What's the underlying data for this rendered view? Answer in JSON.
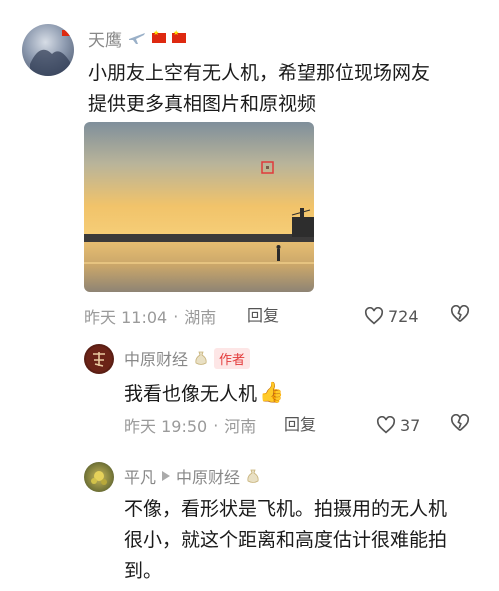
{
  "comment1": {
    "username": "天鹰",
    "text_line1": "小朋友上空有无人机，希望那位现场网友",
    "text_line2": "提供更多真相图片和原视频",
    "time": "昨天 11:04",
    "location": "湖南",
    "reply": "回复",
    "likes": "724"
  },
  "reply1": {
    "username": "中原财经",
    "author_badge": "作者",
    "text": "我看也像无人机",
    "emoji": "👍",
    "time": "昨天 19:50",
    "location": "河南",
    "reply": "回复",
    "likes": "37"
  },
  "reply2": {
    "username": "平凡",
    "reply_to": "中原财经",
    "text_line1": "不像，看形状是飞机。拍摄用的无人机",
    "text_line2": "很小，就这个距离和高度估计很难能拍",
    "text_line3": "到。"
  },
  "icons": {
    "like": "heart-outline-icon",
    "dislike": "broken-heart-icon",
    "plane": "airplane-icon",
    "flag": "china-flag-icon",
    "arrow": "triangle-right-icon"
  },
  "colors": {
    "accent_red": "#e33b3b",
    "meta_gray": "#9a9a9a"
  }
}
